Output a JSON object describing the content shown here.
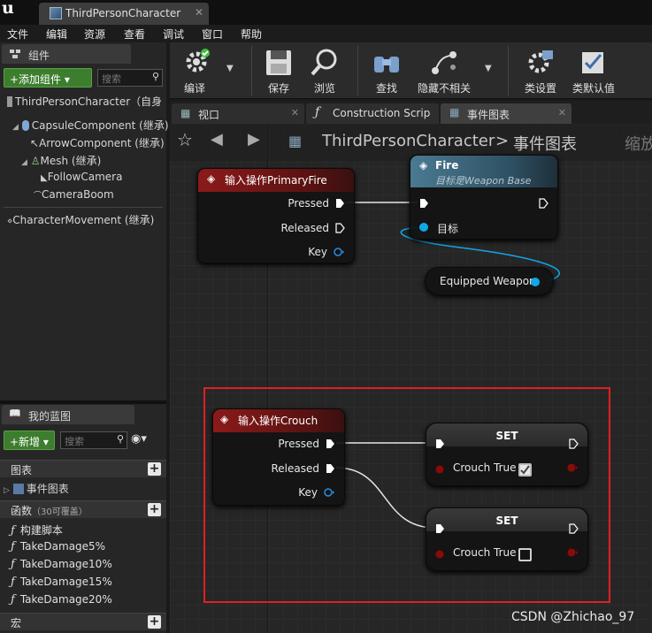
{
  "window": {
    "tab_title": "ThirdPersonCharacter",
    "close": "✕"
  },
  "menu": [
    "文件",
    "编辑",
    "资源",
    "查看",
    "调试",
    "窗口",
    "帮助"
  ],
  "components": {
    "tab_label": "组件",
    "add_button": "+添加组件 ▾",
    "search_placeholder": "搜索",
    "root": "ThirdPersonCharacter（自身",
    "items": [
      "CapsuleComponent (继承)",
      "ArrowComponent (继承)",
      "Mesh (继承)",
      "FollowCamera",
      "CameraBoom",
      "CharacterMovement (继承)"
    ]
  },
  "my_blueprint": {
    "tab_label": "我的蓝图",
    "new_button": "+新增 ▾",
    "search_placeholder": "搜索",
    "sections": {
      "graphs": "图表",
      "event_graph": "事件图表",
      "functions": "函数",
      "functions_count": "（30可覆盖）",
      "macros": "宏"
    },
    "functions": [
      "构建脚本",
      "TakeDamage5%",
      "TakeDamage10%",
      "TakeDamage15%",
      "TakeDamage20%"
    ]
  },
  "toolbar": {
    "compile": "编译",
    "save": "保存",
    "browse": "浏览",
    "find": "查找",
    "hide_unrelated": "隐藏不相关",
    "class_settings": "类设置",
    "class_defaults": "类默认值"
  },
  "editor_tabs": {
    "viewport": "视口",
    "construction": "Construction Scrip",
    "event_graph": "事件图表"
  },
  "breadcrumb": {
    "root": "ThirdPersonCharacter",
    "sep": ">",
    "current": "事件图表",
    "zoom": "缩放"
  },
  "nodes": {
    "primary_fire": {
      "title": "输入操作PrimaryFire",
      "pressed": "Pressed",
      "released": "Released",
      "key": "Key"
    },
    "fire": {
      "title": "Fire",
      "subtitle": "目标是Weapon Base",
      "target": "目标"
    },
    "equipped_weapon": {
      "label": "Equipped Weapon"
    },
    "crouch": {
      "title": "输入操作Crouch",
      "pressed": "Pressed",
      "released": "Released",
      "key": "Key"
    },
    "set1": {
      "title": "SET",
      "label": "Crouch True",
      "checked": true
    },
    "set2": {
      "title": "SET",
      "label": "Crouch True",
      "checked": false
    }
  },
  "watermark": "CSDN @Zhichao_97",
  "colors": {
    "event_header": "#8c1a1a",
    "func_header": "#4b7a92",
    "object_pin": "#11a7e8",
    "bool_pin": "#8a0a0a",
    "selection": "#e02020",
    "add_button": "#3c7e2e"
  }
}
